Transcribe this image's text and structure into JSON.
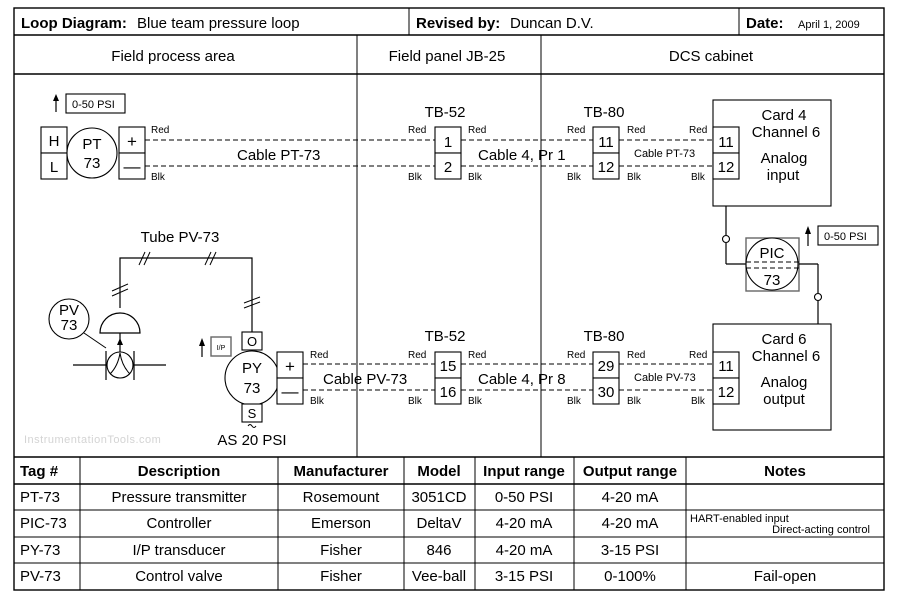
{
  "header": {
    "loop_label": "Loop Diagram:",
    "loop_value": "Blue team pressure loop",
    "revised_label": "Revised by:",
    "revised_value": "Duncan D.V.",
    "date_label": "Date:",
    "date_value": "April 1, 2009"
  },
  "areas": {
    "field": "Field process area",
    "panel": "Field panel JB-25",
    "dcs": "DCS cabinet"
  },
  "transmitter": {
    "range": "0-50 PSI",
    "port_high": "H",
    "port_low": "L",
    "tag_letters": "PT",
    "tag_number": "73",
    "plus": "+",
    "minus": "—",
    "cable": "Cable PT-73"
  },
  "wire_colors": {
    "pos": "Red",
    "neg": "Blk"
  },
  "input_loop": {
    "tb52": {
      "label": "TB-52",
      "terminals": [
        "1",
        "2"
      ]
    },
    "trunk_cable": "Cable 4, Pr 1",
    "tb80": {
      "label": "TB-80",
      "terminals": [
        "11",
        "12"
      ]
    },
    "dcs_cable": "Cable PT-73",
    "card": {
      "terminals": [
        "11",
        "12"
      ],
      "line1": "Card 4",
      "line2": "Channel 6",
      "line3": "Analog",
      "line4": "input"
    }
  },
  "controller": {
    "tag_letters": "PIC",
    "tag_number": "73",
    "range": "0-50 PSI"
  },
  "valve": {
    "tube": "Tube PV-73",
    "tag_letters": "PV",
    "tag_number": "73"
  },
  "transducer": {
    "badge": "I/P",
    "port_out": "O",
    "port_supply": "S",
    "tag_letters": "PY",
    "tag_number": "73",
    "plus": "+",
    "minus": "—",
    "cable": "Cable PV-73",
    "air_supply": "AS 20 PSI"
  },
  "output_loop": {
    "tb52": {
      "label": "TB-52",
      "terminals": [
        "15",
        "16"
      ]
    },
    "trunk_cable": "Cable 4, Pr 8",
    "tb80": {
      "label": "TB-80",
      "terminals": [
        "29",
        "30"
      ]
    },
    "dcs_cable": "Cable PV-73",
    "card": {
      "terminals": [
        "11",
        "12"
      ],
      "line1": "Card 6",
      "line2": "Channel 6",
      "line3": "Analog",
      "line4": "output"
    }
  },
  "watermark": "InstrumentationTools.com",
  "table": {
    "headers": [
      "Tag #",
      "Description",
      "Manufacturer",
      "Model",
      "Input range",
      "Output range",
      "Notes"
    ],
    "rows": [
      {
        "tag": "PT-73",
        "description": "Pressure transmitter",
        "manufacturer": "Rosemount",
        "model": "3051CD",
        "input": "0-50 PSI",
        "output": "4-20 mA",
        "notes": "",
        "notes2": ""
      },
      {
        "tag": "PIC-73",
        "description": "Controller",
        "manufacturer": "Emerson",
        "model": "DeltaV",
        "input": "4-20 mA",
        "output": "4-20 mA",
        "notes": "HART-enabled input",
        "notes2": "Direct-acting control"
      },
      {
        "tag": "PY-73",
        "description": "I/P transducer",
        "manufacturer": "Fisher",
        "model": "846",
        "input": "4-20 mA",
        "output": "3-15 PSI",
        "notes": "",
        "notes2": ""
      },
      {
        "tag": "PV-73",
        "description": "Control valve",
        "manufacturer": "Fisher",
        "model": "Vee-ball",
        "input": "3-15 PSI",
        "output": "0-100%",
        "notes": "Fail-open",
        "notes2": ""
      }
    ]
  }
}
